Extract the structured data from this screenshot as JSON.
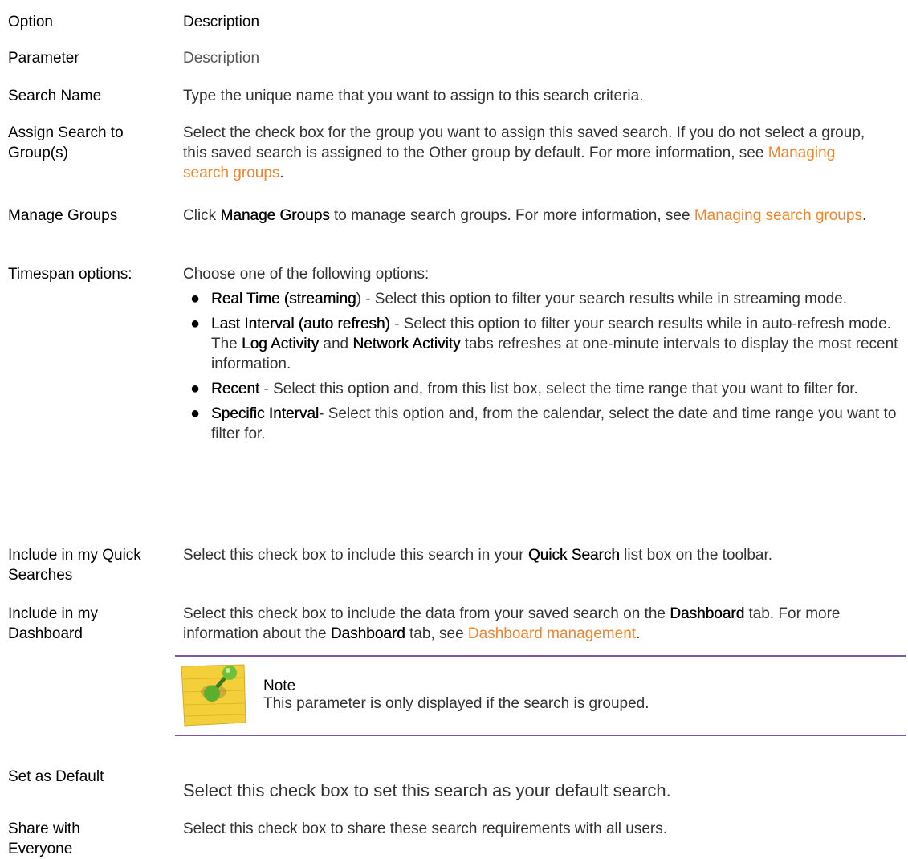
{
  "header": {
    "col1": "Option",
    "col2": "Description"
  },
  "subheader": {
    "col1": "Parameter",
    "col2": "Description"
  },
  "rows": {
    "search_name": {
      "label": "Search Name",
      "desc": "Type the unique name that you want to assign to this search criteria."
    },
    "assign_groups": {
      "label": "Assign Search to Group(s)",
      "desc_pre": "Select the check box for the group you want to assign this saved search. If you do not select a group, this saved search is assigned to the Other group by default. For more information, see ",
      "link": "Managing search groups",
      "desc_post": "."
    },
    "manage_groups": {
      "label": "Manage Groups",
      "desc_pre": "Click ",
      "bold": "Manage Groups",
      "desc_mid": " to manage search groups. For more information, see ",
      "link": "Managing search groups",
      "desc_post": "."
    },
    "timespan": {
      "label": "Timespan options:",
      "intro": "Choose one of the following options:",
      "items": [
        {
          "bold": "Real Time (streaming",
          "text": ") - Select this option to filter your search results while in streaming mode."
        },
        {
          "bold": "Last Interval (auto refresh)",
          "text_a": " - Select this option to filter your search results while in auto-refresh mode. The ",
          "bold2": "Log Activity",
          "text_b": " and ",
          "bold3": "Network Activity",
          "text_c": " tabs refreshes at one-minute intervals to display the most recent information."
        },
        {
          "bold": "Recent",
          "text": " - Select this option and, from this list box, select the time range that you want to filter for."
        },
        {
          "bold": "Specific Interval",
          "text": "- Select this option and, from the calendar, select the date and time range you want to filter for."
        }
      ]
    },
    "quick_searches": {
      "label": "Include in my Quick Searches",
      "desc_pre": "Select this check box to include this search in your ",
      "bold": "Quick Search",
      "desc_post": " list box on the toolbar."
    },
    "dashboard": {
      "label": "Include in my Dashboard",
      "desc_a": "Select this check box to include the data from your saved search on the ",
      "bold1": "Dashboard",
      "desc_b": " tab. For more information about the ",
      "bold2": "Dashboard",
      "desc_c": " tab, see ",
      "link": "Dashboard management",
      "desc_d": "."
    },
    "note": {
      "title": "Note",
      "text": "This parameter is only displayed if the search is grouped.",
      "icon": "note-pad-pushpin-icon"
    },
    "set_default": {
      "label": "Set as Default",
      "desc": "Select this check box to set this search as your default search."
    },
    "share": {
      "label": "Share with Everyone",
      "desc": "Select this check box to share these search requirements with all users."
    }
  },
  "colors": {
    "link": "#f0852d",
    "note_rule": "#7a55a8"
  }
}
